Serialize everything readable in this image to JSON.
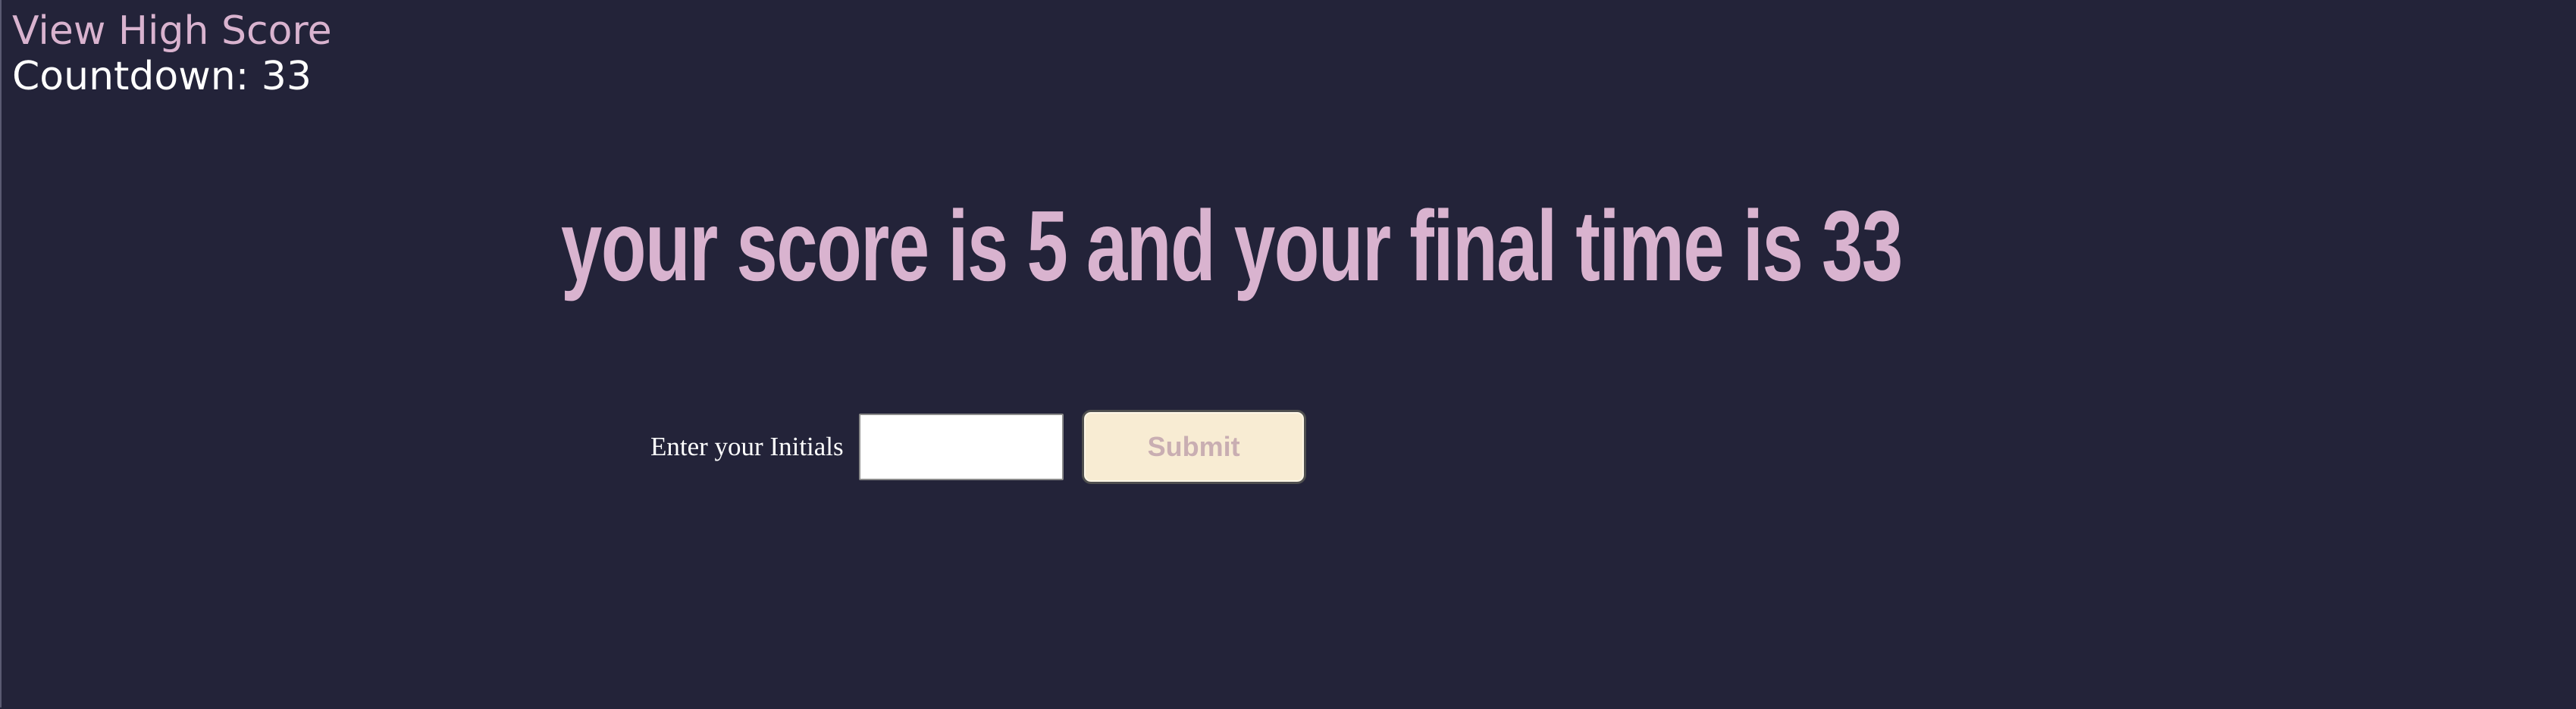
{
  "header": {
    "high_score_link": "View High Score",
    "countdown_label": "Countdown: 33"
  },
  "result": {
    "message": "your score is 5 and your final time is 33"
  },
  "form": {
    "initials_label": "Enter your Initials",
    "initials_value": "",
    "submit_label": "Submit"
  },
  "colors": {
    "background": "#232339",
    "accent_pink": "#d9b3cf",
    "button_fill": "#f8ecd3",
    "button_text": "#c9aeb2"
  }
}
